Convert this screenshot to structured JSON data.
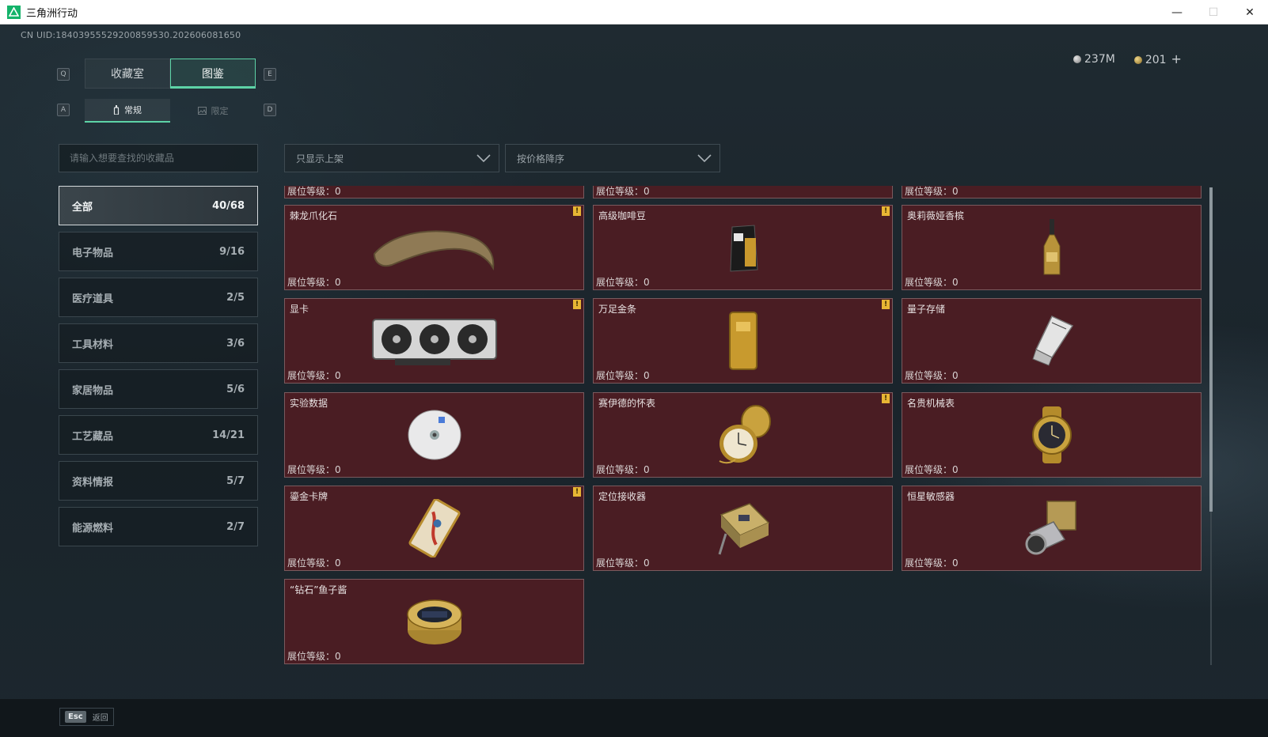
{
  "window": {
    "title": "三角洲行动",
    "minimize": "—",
    "maximize": "☐",
    "close": "✕"
  },
  "uid": "CN UID:18403955529200859530.202606081650",
  "currency": {
    "silver": "237M",
    "gold": "201",
    "add": "+"
  },
  "keys": {
    "q": "Q",
    "e": "E",
    "a": "A",
    "d": "D"
  },
  "main_tabs": [
    {
      "label": "收藏室"
    },
    {
      "label": "图鉴"
    }
  ],
  "sub_tabs": [
    {
      "label": "常规"
    },
    {
      "label": "限定"
    }
  ],
  "search": {
    "placeholder": "请输入想要查找的收藏品"
  },
  "filters": {
    "availability": "只显示上架",
    "sort": "按价格降序"
  },
  "categories": [
    {
      "label": "全部",
      "count": "40/68"
    },
    {
      "label": "电子物品",
      "count": "9/16"
    },
    {
      "label": "医疗道具",
      "count": "2/5"
    },
    {
      "label": "工具材料",
      "count": "3/6"
    },
    {
      "label": "家居物品",
      "count": "5/6"
    },
    {
      "label": "工艺藏品",
      "count": "14/21"
    },
    {
      "label": "资料情报",
      "count": "5/7"
    },
    {
      "label": "能源燃料",
      "count": "2/7"
    }
  ],
  "level_label": "展位等级：",
  "level_value": "0",
  "items": [
    {
      "name": "棘龙爪化石",
      "badge": true,
      "icon": "claw-fossil-icon"
    },
    {
      "name": "高级咖啡豆",
      "badge": true,
      "icon": "coffee-bag-icon"
    },
    {
      "name": "奥莉薇娅香槟",
      "badge": false,
      "icon": "champagne-bottle-icon"
    },
    {
      "name": "显卡",
      "badge": true,
      "icon": "graphics-card-icon"
    },
    {
      "name": "万足金条",
      "badge": true,
      "icon": "gold-bar-icon"
    },
    {
      "name": "量子存储",
      "badge": false,
      "icon": "usb-drive-icon"
    },
    {
      "name": "实验数据",
      "badge": false,
      "icon": "disc-icon"
    },
    {
      "name": "赛伊德的怀表",
      "badge": true,
      "icon": "pocket-watch-icon"
    },
    {
      "name": "名贵机械表",
      "badge": false,
      "icon": "wristwatch-icon"
    },
    {
      "name": "鎏金卡牌",
      "badge": true,
      "icon": "gilded-card-icon"
    },
    {
      "name": "定位接收器",
      "badge": false,
      "icon": "gps-receiver-icon"
    },
    {
      "name": "恒星敏感器",
      "badge": false,
      "icon": "star-sensor-icon"
    },
    {
      "name": "“钻石”鱼子酱",
      "badge": false,
      "icon": "caviar-tin-icon"
    }
  ],
  "footer": {
    "esc_key": "Esc",
    "back": "返回"
  },
  "colors": {
    "accent": "#5dd3a7",
    "card_bg": "#4a1d23",
    "badge": "#e8b634"
  }
}
